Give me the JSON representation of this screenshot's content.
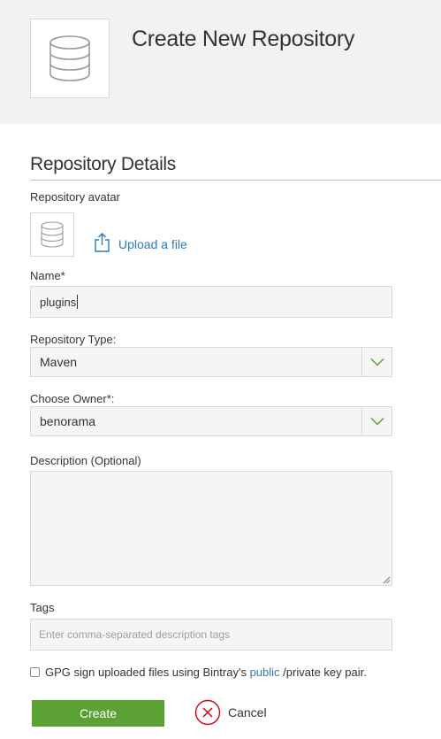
{
  "header": {
    "title": "Create New Repository",
    "avatar_icon": "database-icon"
  },
  "section": {
    "title": "Repository Details"
  },
  "avatar": {
    "label": "Repository avatar",
    "icon": "database-icon",
    "upload_icon": "upload-icon",
    "upload_label": "Upload a file"
  },
  "name": {
    "label": "Name*",
    "value": "plugins"
  },
  "repo_type": {
    "label": "Repository Type:",
    "value": "Maven",
    "icon": "chevron-down-icon"
  },
  "owner": {
    "label": "Choose Owner*:",
    "value": "benorama",
    "icon": "chevron-down-icon"
  },
  "description": {
    "label": "Description (Optional)",
    "value": ""
  },
  "tags": {
    "label": "Tags",
    "placeholder": "Enter comma-separated description tags"
  },
  "gpg": {
    "text_before": "GPG sign uploaded files using Bintray's",
    "link": "public",
    "text_after": "/private key pair.",
    "checked": false
  },
  "actions": {
    "create_label": "Create",
    "cancel_label": "Cancel",
    "cancel_icon": "close-circle-icon"
  },
  "colors": {
    "accent_green": "#5ba133",
    "link_blue": "#2a7ab8",
    "cancel_red": "#d0021b",
    "chevron_green": "#5ba133"
  }
}
